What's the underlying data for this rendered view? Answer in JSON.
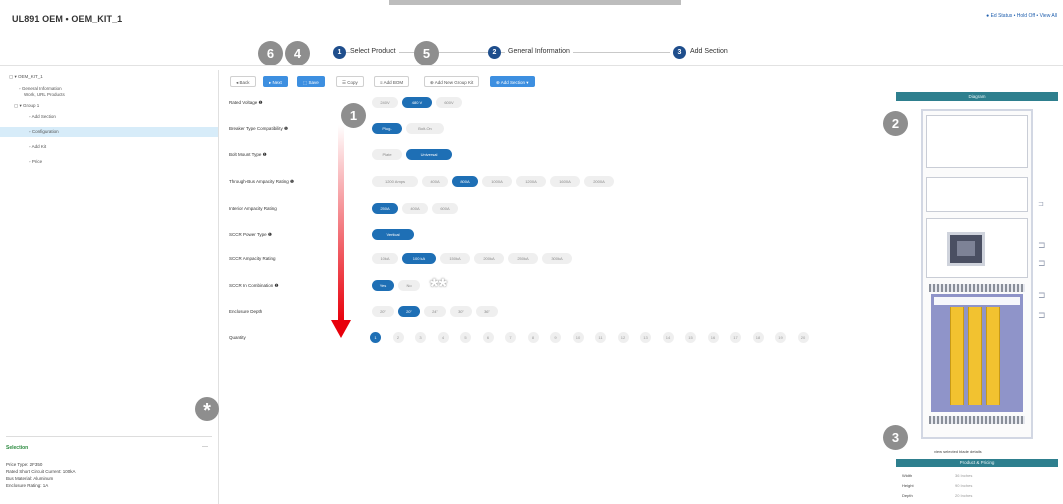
{
  "app": {
    "title": "UL891 OEM • OEM_KIT_1",
    "top_right_links": "● Ed Status • Hold Off • View All"
  },
  "wizard": {
    "steps": [
      {
        "num": "1",
        "label": "Select Product"
      },
      {
        "num": "2",
        "label": "General Information"
      },
      {
        "num": "3",
        "label": "Add Section"
      }
    ]
  },
  "callouts": {
    "c1": "1",
    "c2": "2",
    "c3": "3",
    "c4": "4",
    "c5": "5",
    "c6": "6",
    "star_single": "*",
    "star_double": "**"
  },
  "sidebar": {
    "items": [
      {
        "label": "▢ ▾ OEM_KIT_1"
      },
      {
        "label": "◦ General Information"
      },
      {
        "label": "  Work, URL Products"
      },
      {
        "label": "▢ ▾ Group 1"
      },
      {
        "label": "◦ Add Section"
      },
      {
        "label": "◦ Configuration"
      },
      {
        "label": "◦ Add Kit"
      },
      {
        "label": "◦ Price"
      }
    ],
    "details": {
      "title": "Selection",
      "lines": [
        "Price Type: 2F350",
        "Rated Short Circuit Current: 100kA",
        "Bus Material: Aluminum",
        "Enclosure Rating: 1A"
      ]
    }
  },
  "toolbar": {
    "buttons": [
      {
        "label": "◂ Back",
        "style": "plain"
      },
      {
        "label": "▸ Next",
        "style": "blue"
      },
      {
        "label": "⬚ Save",
        "style": "blue"
      },
      {
        "label": "☰ Copy",
        "style": "plain"
      },
      {
        "label": "≡ Add BOM",
        "style": "plain"
      },
      {
        "label": "⊕ Add New Group Kit",
        "style": "plain"
      },
      {
        "label": "⊕ Add Section ▾",
        "style": "blue"
      }
    ]
  },
  "attributes": [
    {
      "label": "Rated Voltage ❶",
      "options": [
        "240V",
        "480 V",
        "600V"
      ],
      "selected": 1
    },
    {
      "label": "Breaker Type Compatibility ❶",
      "options": [
        "Plug-",
        "Bolt-On"
      ],
      "selected": 0
    },
    {
      "label": "Bolt Mount Type ❶",
      "options": [
        "Plate",
        "Universal"
      ],
      "selected": 1
    },
    {
      "label": "Through-Bus Ampacity Rating ❶",
      "options": [
        "1200 Amps",
        "400A",
        "800A",
        "1000A",
        "1200A",
        "1600A",
        "2000A"
      ],
      "selected": 2
    },
    {
      "label": "Interior Ampacity Rating",
      "options": [
        "250A",
        "400A",
        "600A"
      ],
      "selected": 0
    },
    {
      "label": "SCCR Power Type ❶",
      "options": [
        "Vertical"
      ],
      "selected": 0
    },
    {
      "label": "SCCR Ampacity Rating",
      "options": [
        "10kA",
        "100 kA",
        "150kA",
        "200kA",
        "250kA",
        "300kA"
      ],
      "selected": 1
    },
    {
      "label": "SCCR In Combination ❶",
      "options": [
        "Yes",
        "No"
      ],
      "selected": 0
    },
    {
      "label": "Enclosure Depth",
      "options": [
        "20\"",
        "20\"",
        "24\"",
        "30\"",
        "36\""
      ],
      "selected": 1
    }
  ],
  "quantity": {
    "label": "Quantity",
    "values": [
      "1",
      "2",
      "3",
      "4",
      "5",
      "6",
      "7",
      "8",
      "9",
      "10",
      "11",
      "12",
      "13",
      "14",
      "15",
      "16",
      "17",
      "18",
      "19",
      "20"
    ],
    "selected": 0
  },
  "diagram": {
    "header": "Diagram",
    "view_link": "view selected blade details",
    "ratings_header": "Product & Pricing",
    "ratings": [
      {
        "label": "Width",
        "value": "36 Inches"
      },
      {
        "label": "Height",
        "value": "90 Inches"
      },
      {
        "label": "Depth",
        "value": "20 Inches"
      }
    ]
  },
  "colors": {
    "accent_blue": "#1e6fb5",
    "wizard_step": "#1f4e8c",
    "panel_header": "#2e7f8e",
    "callout_gray": "#8e8e8e",
    "arrow_red": "#e8000b",
    "busbar_yellow": "#f2c230"
  }
}
